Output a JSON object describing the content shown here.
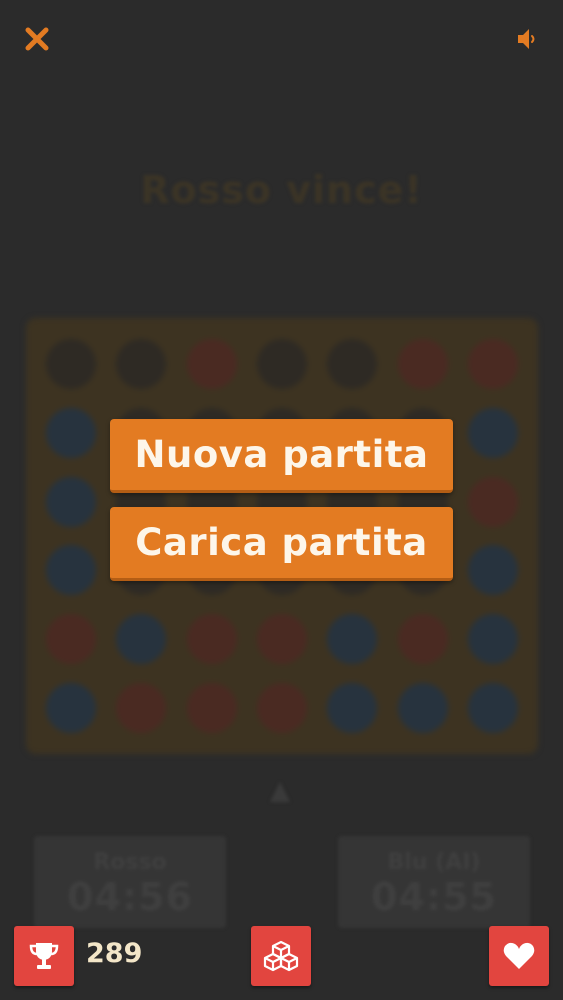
{
  "top_bar": {
    "close_icon": "close-icon",
    "sound_icon": "speaker-icon"
  },
  "title": "Rosso vince!",
  "board": {
    "rows": [
      [
        "empty",
        "empty",
        "red",
        "empty",
        "empty",
        "red",
        "red"
      ],
      [
        "blue",
        "empty",
        "empty",
        "empty",
        "empty",
        "empty",
        "blue"
      ],
      [
        "blue",
        "empty",
        "empty",
        "empty",
        "empty",
        "empty",
        "red"
      ],
      [
        "blue",
        "empty",
        "empty",
        "empty",
        "empty",
        "empty",
        "blue"
      ],
      [
        "red",
        "blue",
        "red",
        "red",
        "blue",
        "red",
        "blue"
      ],
      [
        "blue",
        "red",
        "red",
        "red",
        "blue",
        "blue",
        "blue"
      ]
    ]
  },
  "players": {
    "red": {
      "name": "Rosso",
      "time": "04:56"
    },
    "blue": {
      "name": "Blu (AI)",
      "time": "04:55"
    }
  },
  "menu": {
    "new_game": "Nuova partita",
    "load_game": "Carica partita"
  },
  "bottom_bar": {
    "score": "289",
    "trophy_icon": "trophy-icon",
    "blocks_icon": "blocks-icon",
    "heart_icon": "heart-icon"
  },
  "colors": {
    "accent": "#e37b22",
    "danger": "#e2453f",
    "background": "#2b2b2b"
  }
}
